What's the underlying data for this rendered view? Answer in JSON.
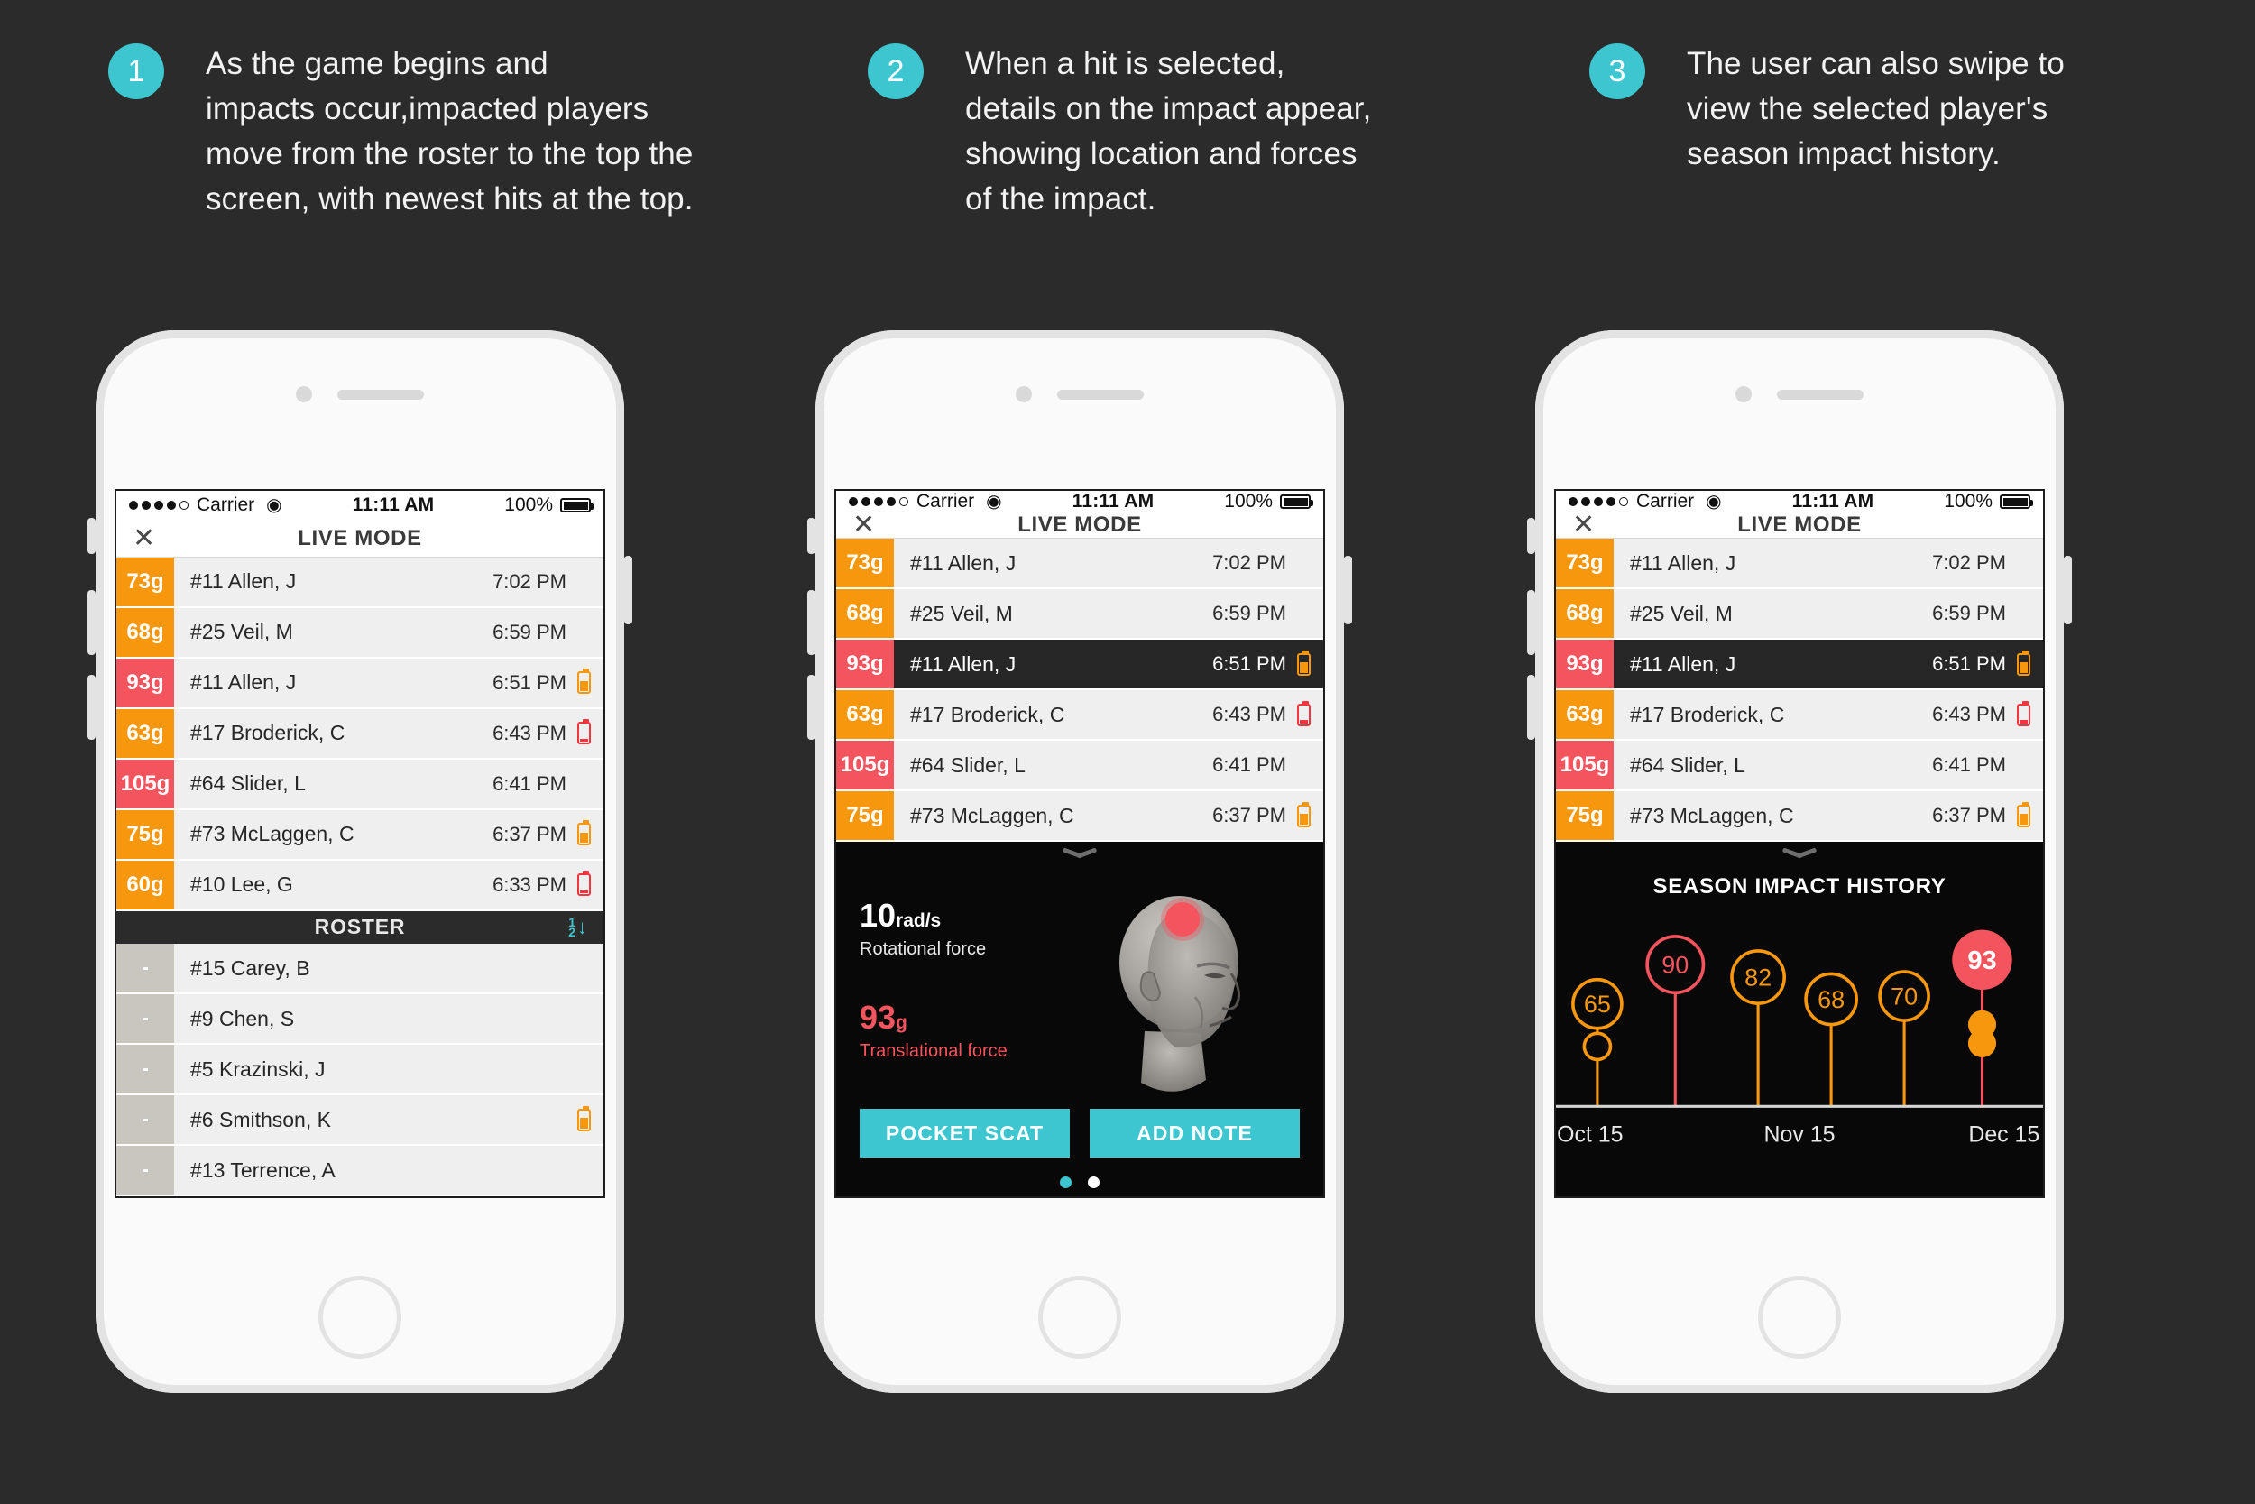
{
  "captions": [
    {
      "num": "1",
      "text": "As the game begins and\nimpacts occur,impacted players\nmove from the roster to the top the\nscreen, with newest hits at the top."
    },
    {
      "num": "2",
      "text": "When a hit is selected,\ndetails on the impact appear,\nshowing location and forces\nof the impact."
    },
    {
      "num": "3",
      "text": "The user can also swipe to\nview the selected player's\nseason impact history."
    }
  ],
  "status_bar": {
    "carrier": "Carrier",
    "time": "11:11 AM",
    "battery": "100%"
  },
  "navbar": {
    "title": "LIVE MODE",
    "close_icon": "close-icon"
  },
  "hits": [
    {
      "g": "73g",
      "level": "orange",
      "name": "#11 Allen, J",
      "time": "7:02 PM",
      "battery": "none"
    },
    {
      "g": "68g",
      "level": "orange",
      "name": "#25 Veil, M",
      "time": "6:59 PM",
      "battery": "none"
    },
    {
      "g": "93g",
      "level": "red",
      "name": "#11 Allen, J",
      "time": "6:51 PM",
      "battery": "orange"
    },
    {
      "g": "63g",
      "level": "orange",
      "name": "#17 Broderick, C",
      "time": "6:43 PM",
      "battery": "red"
    },
    {
      "g": "105g",
      "level": "red",
      "name": "#64 Slider, L",
      "time": "6:41 PM",
      "battery": "none"
    },
    {
      "g": "75g",
      "level": "orange",
      "name": "#73 McLaggen, C",
      "time": "6:37 PM",
      "battery": "orange"
    },
    {
      "g": "60g",
      "level": "orange",
      "name": "#10 Lee, G",
      "time": "6:33 PM",
      "battery": "red"
    }
  ],
  "selected_hit_index": 2,
  "roster": {
    "title": "ROSTER",
    "sort_icon": "sort-numeric-down-icon",
    "sort_digits": [
      "1",
      "2"
    ],
    "sort_arrow": "↓",
    "players": [
      {
        "g": "-",
        "name": "#15 Carey, B",
        "battery": "none"
      },
      {
        "g": "-",
        "name": "#9 Chen, S",
        "battery": "none"
      },
      {
        "g": "-",
        "name": "#5 Krazinski, J",
        "battery": "none"
      },
      {
        "g": "-",
        "name": "#6 Smithson, K",
        "battery": "orange"
      },
      {
        "g": "-",
        "name": "#13 Terrence, A",
        "battery": "none"
      }
    ]
  },
  "detail": {
    "grabber_icon": "chevron-down-icon",
    "rotational": {
      "value": "10",
      "unit": "rad/s",
      "label": "Rotational force"
    },
    "translational": {
      "value": "93",
      "unit": "g",
      "label": "Translational force"
    },
    "head_icon": "head-impact-diagram",
    "impact_marker_color": "#f4545e",
    "buttons": [
      {
        "label": "POCKET SCAT",
        "name": "pocket-scat-button"
      },
      {
        "label": "ADD NOTE",
        "name": "add-note-button"
      }
    ],
    "pager": {
      "active_index": 0,
      "count": 2
    }
  },
  "history": {
    "grabber_icon": "chevron-down-icon",
    "title": "SEASON IMPACT HISTORY",
    "pager": {
      "active_index": 1,
      "count": 2
    }
  },
  "colors": {
    "accent_teal": "#3dc6d0",
    "warn_orange": "#f7970d",
    "alert_red": "#f4545e",
    "background": "#2b2b2b",
    "panel_black": "#080808"
  },
  "chart_data": {
    "type": "scatter",
    "title": "SEASON IMPACT HISTORY",
    "xlabel": "",
    "ylabel": "",
    "grid": false,
    "legend": "none",
    "xticks": [
      "Oct 15",
      "Nov 15",
      "Dec 15"
    ],
    "xtick_positions": [
      0.07,
      0.5,
      0.92
    ],
    "ylim": [
      0,
      110
    ],
    "points": [
      {
        "x": 0.085,
        "value": 65,
        "color": "#f7970d",
        "style": "outline",
        "radius": 26
      },
      {
        "x": 0.085,
        "value": 38,
        "color": "#f7970d",
        "style": "outline-small",
        "radius": 14,
        "label": ""
      },
      {
        "x": 0.245,
        "value": 90,
        "color": "#f4545e",
        "style": "outline",
        "radius": 30
      },
      {
        "x": 0.415,
        "value": 82,
        "color": "#f7970d",
        "style": "outline",
        "radius": 28
      },
      {
        "x": 0.565,
        "value": 68,
        "color": "#f7970d",
        "style": "outline",
        "radius": 27
      },
      {
        "x": 0.715,
        "value": 70,
        "color": "#f7970d",
        "style": "outline",
        "radius": 26
      },
      {
        "x": 0.875,
        "value": 93,
        "color": "#f4545e",
        "style": "filled",
        "radius": 32
      },
      {
        "x": 0.875,
        "value": 52,
        "color": "#f7970d",
        "style": "filled-small",
        "radius": 15,
        "label": ""
      },
      {
        "x": 0.875,
        "value": 40,
        "color": "#f7970d",
        "style": "filled-small",
        "radius": 15,
        "label": ""
      }
    ]
  }
}
